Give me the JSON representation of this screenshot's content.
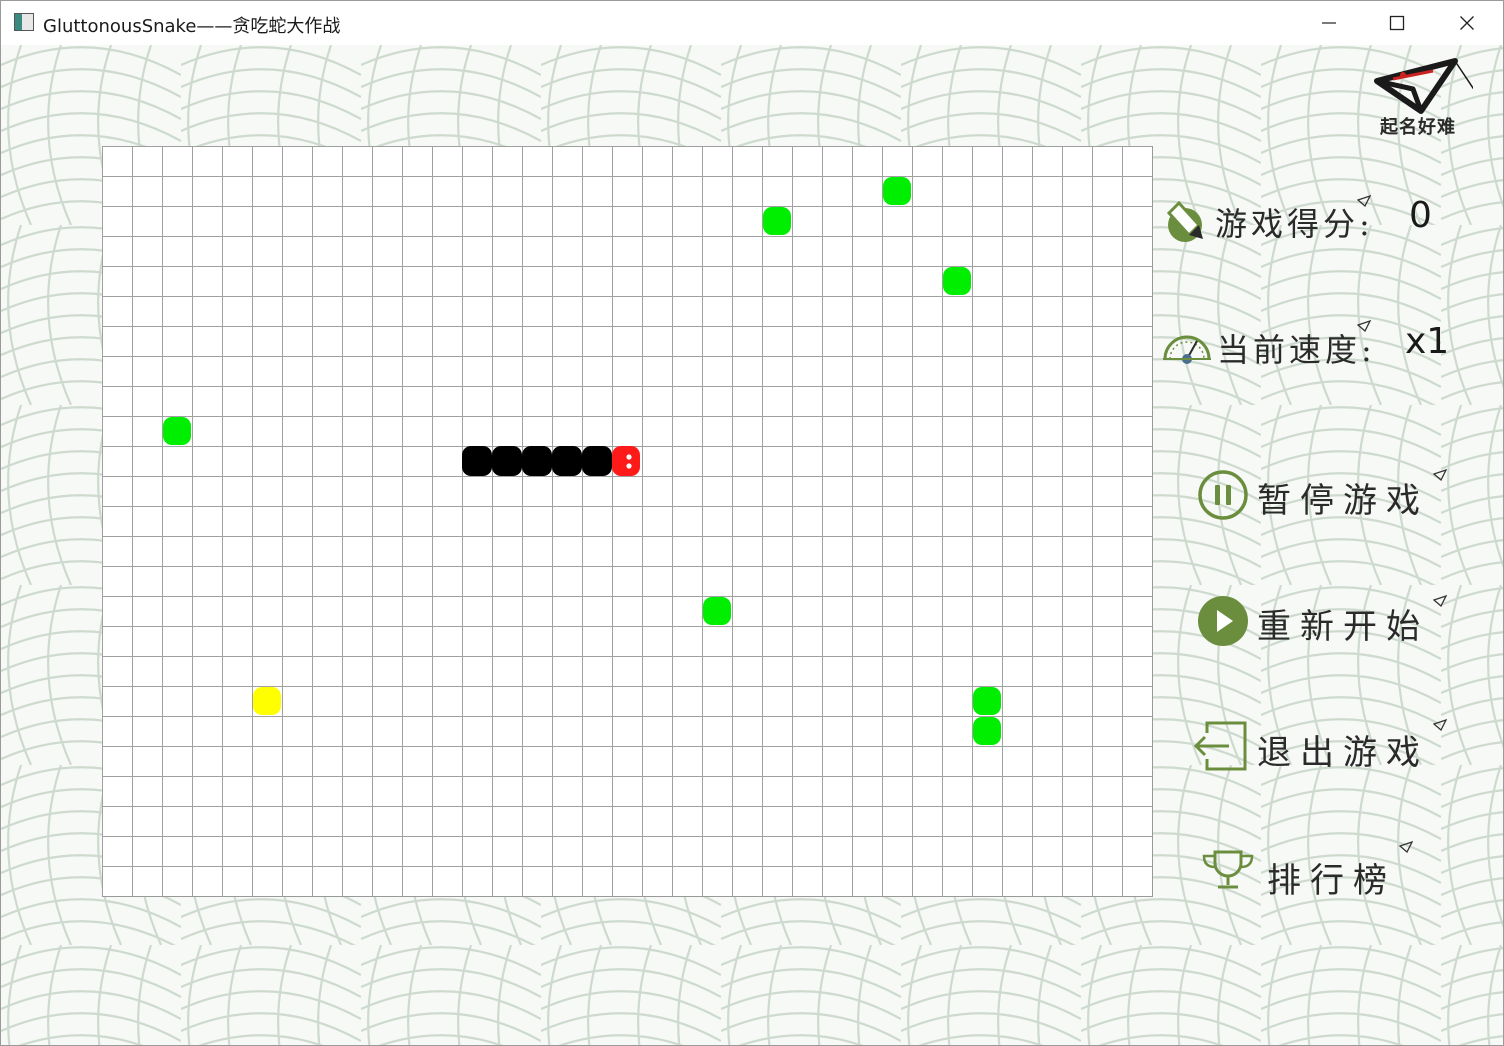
{
  "window": {
    "title": "GluttonousSnake——贪吃蛇大作战",
    "controls": [
      "minimize",
      "maximize",
      "close"
    ]
  },
  "logo": {
    "text": "起名好难",
    "icon": "paper-plane-icon"
  },
  "colors": {
    "snake_body": "#000000",
    "snake_head": "#ff1a1a",
    "food": "#00ee00",
    "special_food": "#ffff00",
    "accent": "#6b8e3e",
    "grid_line": "#a0a0a0"
  },
  "board": {
    "columns": 35,
    "rows": 25,
    "snake": {
      "head": {
        "col": 17,
        "row": 10,
        "direction": "right"
      },
      "body": [
        {
          "col": 12,
          "row": 10
        },
        {
          "col": 13,
          "row": 10
        },
        {
          "col": 14,
          "row": 10
        },
        {
          "col": 15,
          "row": 10
        },
        {
          "col": 16,
          "row": 10
        }
      ]
    },
    "food": [
      {
        "col": 26,
        "row": 1
      },
      {
        "col": 22,
        "row": 2
      },
      {
        "col": 28,
        "row": 4
      },
      {
        "col": 2,
        "row": 9
      },
      {
        "col": 20,
        "row": 15
      },
      {
        "col": 29,
        "row": 18
      },
      {
        "col": 29,
        "row": 19
      }
    ],
    "special_food": [
      {
        "col": 5,
        "row": 18
      }
    ]
  },
  "stats": {
    "score_label": "游戏得分:",
    "score_value": "0",
    "speed_label": "当前速度:",
    "speed_value": "x1"
  },
  "menu": {
    "pause": "暂停游戏",
    "restart": "重新开始",
    "exit": "退出游戏",
    "leaderboard": "排行榜"
  }
}
